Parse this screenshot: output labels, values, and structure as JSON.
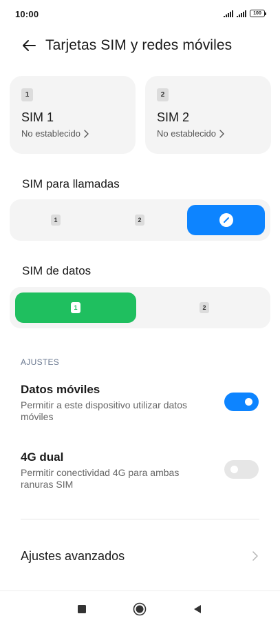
{
  "status_bar": {
    "time": "10:00",
    "battery": "100"
  },
  "header": {
    "title": "Tarjetas SIM y redes móviles",
    "back_icon": "arrow-left-icon"
  },
  "sim_cards": [
    {
      "badge": "1",
      "name": "SIM 1",
      "status": "No establecido"
    },
    {
      "badge": "2",
      "name": "SIM 2",
      "status": "No establecido"
    }
  ],
  "calls": {
    "label": "SIM para llamadas",
    "options": [
      {
        "badge": "1"
      },
      {
        "badge": "2"
      },
      {
        "icon": "edit-icon",
        "selected": true
      }
    ]
  },
  "data": {
    "label": "SIM de datos",
    "options": [
      {
        "badge": "1",
        "selected": true
      },
      {
        "badge": "2"
      }
    ]
  },
  "ajustes": {
    "section": "AJUSTES",
    "mobile_data": {
      "title": "Datos móviles",
      "description": "Permitir a este dispositivo utilizar datos móviles",
      "enabled": true
    },
    "dual_4g": {
      "title": "4G dual",
      "description": "Permitir conectividad 4G para ambas ranuras SIM",
      "enabled": false
    },
    "advanced": {
      "label": "Ajustes avanzados"
    }
  },
  "colors": {
    "accent_blue": "#0d84ff",
    "accent_green": "#1fbf5f",
    "card_bg": "#f4f4f4"
  },
  "nav_bar": {
    "buttons": [
      "recents-square-icon",
      "home-circle-icon",
      "back-triangle-icon"
    ]
  }
}
